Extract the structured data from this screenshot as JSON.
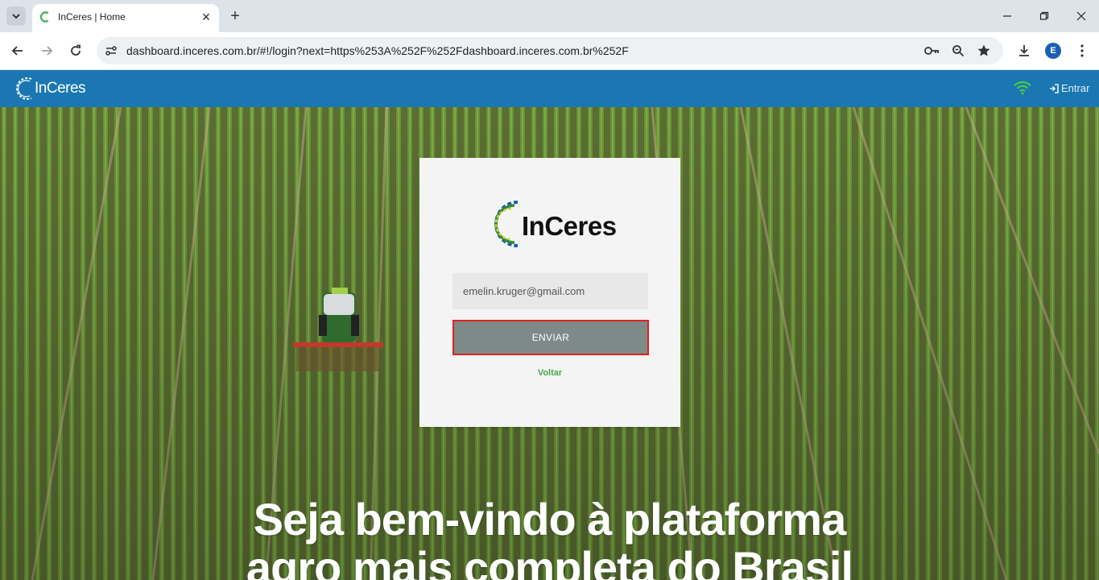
{
  "browser": {
    "tab": {
      "title": "InCeres | Home",
      "close_icon": "close-icon"
    },
    "new_tab_icon": "plus-icon",
    "url": "dashboard.inceres.com.br/#!/login?next=https%253A%252F%252Fdashboard.inceres.com.br%252F",
    "profile_initial": "E",
    "colors": {
      "tabbar": "#dee3e9",
      "profile": "#1a5fb4"
    }
  },
  "appbar": {
    "brand": "InCeres",
    "login_link": "Entrar",
    "colors": {
      "background": "#1a77b1",
      "wifi": "#4cc94c"
    }
  },
  "login": {
    "brand": "InCeres",
    "email_value": "emelin.kruger@gmail.com",
    "submit_label": "ENVIAR",
    "back_label": "Voltar",
    "colors": {
      "button": "#7d8a88",
      "highlight_border": "#e32020",
      "link": "#4caa4c"
    }
  },
  "hero": {
    "line1": "Seja bem-vindo à plataforma",
    "line2": "agro mais completa do Brasil"
  }
}
